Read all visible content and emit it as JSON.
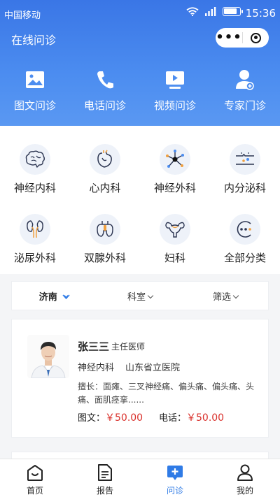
{
  "status_bar": {
    "carrier": "中国移动",
    "time": "15:36"
  },
  "navbar": {
    "title": "在线问诊",
    "more_icon": "more-dots-icon",
    "close_icon": "target-icon"
  },
  "colors": {
    "header_start": "#3a76e6",
    "header_end": "#5a98f2",
    "accent": "#2f7be6",
    "price": "#d9302b"
  },
  "quick_actions": [
    {
      "label": "图文问诊",
      "icon": "image-icon"
    },
    {
      "label": "电话问诊",
      "icon": "phone-icon"
    },
    {
      "label": "视频问诊",
      "icon": "video-icon"
    },
    {
      "label": "专家门诊",
      "icon": "doctor-icon"
    }
  ],
  "departments": [
    {
      "label": "神经内科",
      "icon": "brain-icon"
    },
    {
      "label": "心内科",
      "icon": "heart-icon"
    },
    {
      "label": "神经外科",
      "icon": "neuron-icon"
    },
    {
      "label": "内分泌科",
      "icon": "endocrine-icon"
    },
    {
      "label": "泌尿外科",
      "icon": "kidney-icon"
    },
    {
      "label": "双腺外科",
      "icon": "thyroid-icon"
    },
    {
      "label": "妇科",
      "icon": "uterus-icon"
    },
    {
      "label": "全部分类",
      "icon": "all-categories-icon"
    }
  ],
  "filters": {
    "city": "济南",
    "dept": "科室",
    "screen": "筛选"
  },
  "doctor": {
    "name": "张三三",
    "title": "主任医师",
    "department": "神经内科",
    "hospital": "山东省立医院",
    "specialty": "擅长：面瘫、三叉神经痛、偏头痛、偏头痛、头痛、面肌痉挛......",
    "text_label": "图文：",
    "text_price": "￥50.00",
    "phone_label": "电话：",
    "phone_price": "￥50.00"
  },
  "tabs": [
    {
      "label": "首页",
      "icon": "home-icon"
    },
    {
      "label": "报告",
      "icon": "report-icon"
    },
    {
      "label": "问诊",
      "icon": "consult-icon"
    },
    {
      "label": "我的",
      "icon": "profile-icon"
    }
  ]
}
